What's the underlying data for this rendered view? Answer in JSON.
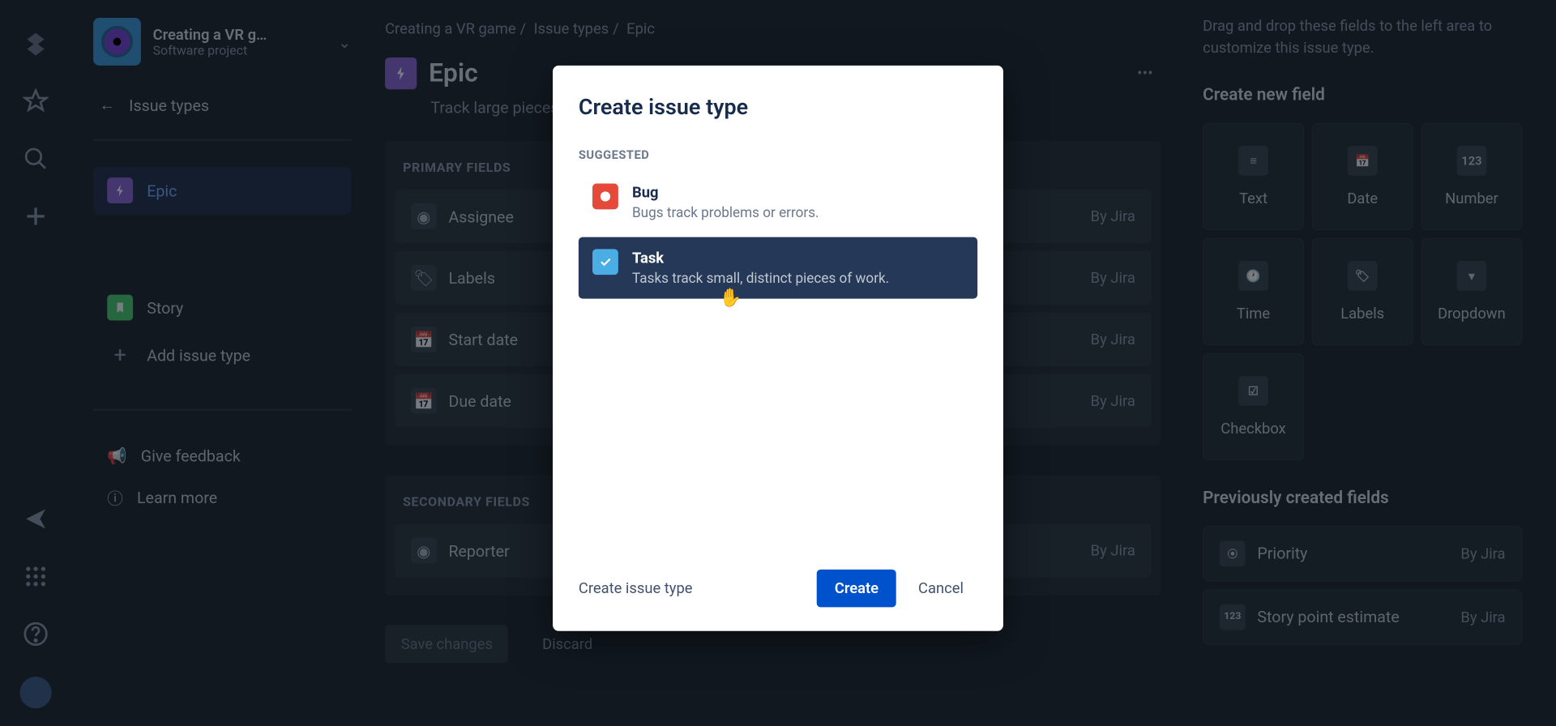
{
  "rail": {
    "icons": [
      "logo",
      "star",
      "search",
      "plus",
      "send",
      "apps",
      "help",
      "avatar"
    ]
  },
  "project": {
    "name": "Creating a VR g…",
    "type": "Software project"
  },
  "sidebar": {
    "back_label": "Issue types",
    "items": [
      {
        "label": "Epic",
        "active": true,
        "kind": "epic"
      },
      {
        "label": "Story",
        "active": false,
        "kind": "story"
      }
    ],
    "add_label": "Add issue type",
    "help": [
      {
        "label": "Give feedback"
      },
      {
        "label": "Learn more"
      }
    ]
  },
  "breadcrumbs": [
    "Creating a VR game",
    "Issue types",
    "Epic"
  ],
  "page": {
    "title": "Epic",
    "subtitle": "Track large pieces of work to completion."
  },
  "primary": {
    "heading": "PRIMARY FIELDS",
    "rows": [
      {
        "label": "Assignee",
        "source": "By Jira",
        "icon": "user"
      },
      {
        "label": "Labels",
        "source": "By Jira",
        "icon": "tag"
      },
      {
        "label": "Start date",
        "source": "By Jira",
        "icon": "calendar"
      },
      {
        "label": "Due date",
        "source": "By Jira",
        "icon": "calendar"
      }
    ]
  },
  "secondary": {
    "heading": "SECONDARY FIELDS",
    "rows": [
      {
        "label": "Reporter",
        "source": "By Jira",
        "icon": "user"
      }
    ]
  },
  "footer": {
    "save": "Save changes",
    "discard": "Discard"
  },
  "rightPanel": {
    "hint": "Drag and drop these fields to the left area to customize this issue type.",
    "create_heading": "Create new field",
    "field_types": [
      {
        "label": "Text",
        "glyph": "≡"
      },
      {
        "label": "Date",
        "glyph": "📅"
      },
      {
        "label": "Number",
        "glyph": "123"
      },
      {
        "label": "Time",
        "glyph": "🕐"
      },
      {
        "label": "Labels",
        "glyph": "🏷"
      },
      {
        "label": "Dropdown",
        "glyph": "▾"
      },
      {
        "label": "Checkbox",
        "glyph": "☑"
      }
    ],
    "prev_heading": "Previously created fields",
    "prev": [
      {
        "label": "Priority",
        "source": "By Jira",
        "glyph": "⦿"
      },
      {
        "label": "Story point estimate",
        "source": "By Jira",
        "glyph": "123"
      }
    ]
  },
  "modal": {
    "title": "Create issue type",
    "suggested_label": "SUGGESTED",
    "options": [
      {
        "name": "Bug",
        "desc": "Bugs track problems or errors.",
        "kind": "bug",
        "selected": false
      },
      {
        "name": "Task",
        "desc": "Tasks track small, distinct pieces of work.",
        "kind": "task",
        "selected": true
      }
    ],
    "link": "Create issue type",
    "create": "Create",
    "cancel": "Cancel"
  }
}
